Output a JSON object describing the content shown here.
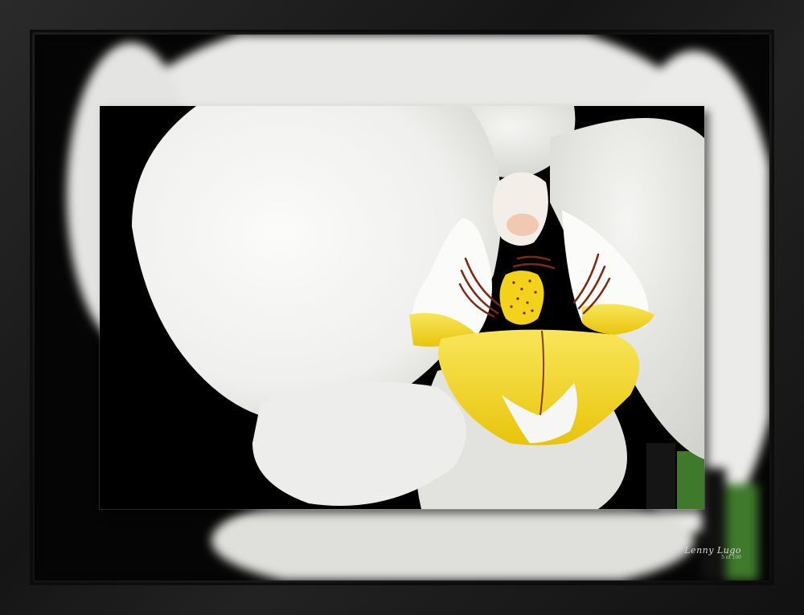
{
  "colors": {
    "frame": "#1c1c1c",
    "background": "#050505",
    "petal": "#f4f4f2",
    "petal_shadow": "#dcdcd8",
    "lip_yellow": "#f2d21a",
    "lip_stripes": "#7a2a12",
    "stem_green": "#3f7a2c"
  },
  "signature": {
    "name": "Lenny Lugo",
    "edition": "5 of 100"
  }
}
